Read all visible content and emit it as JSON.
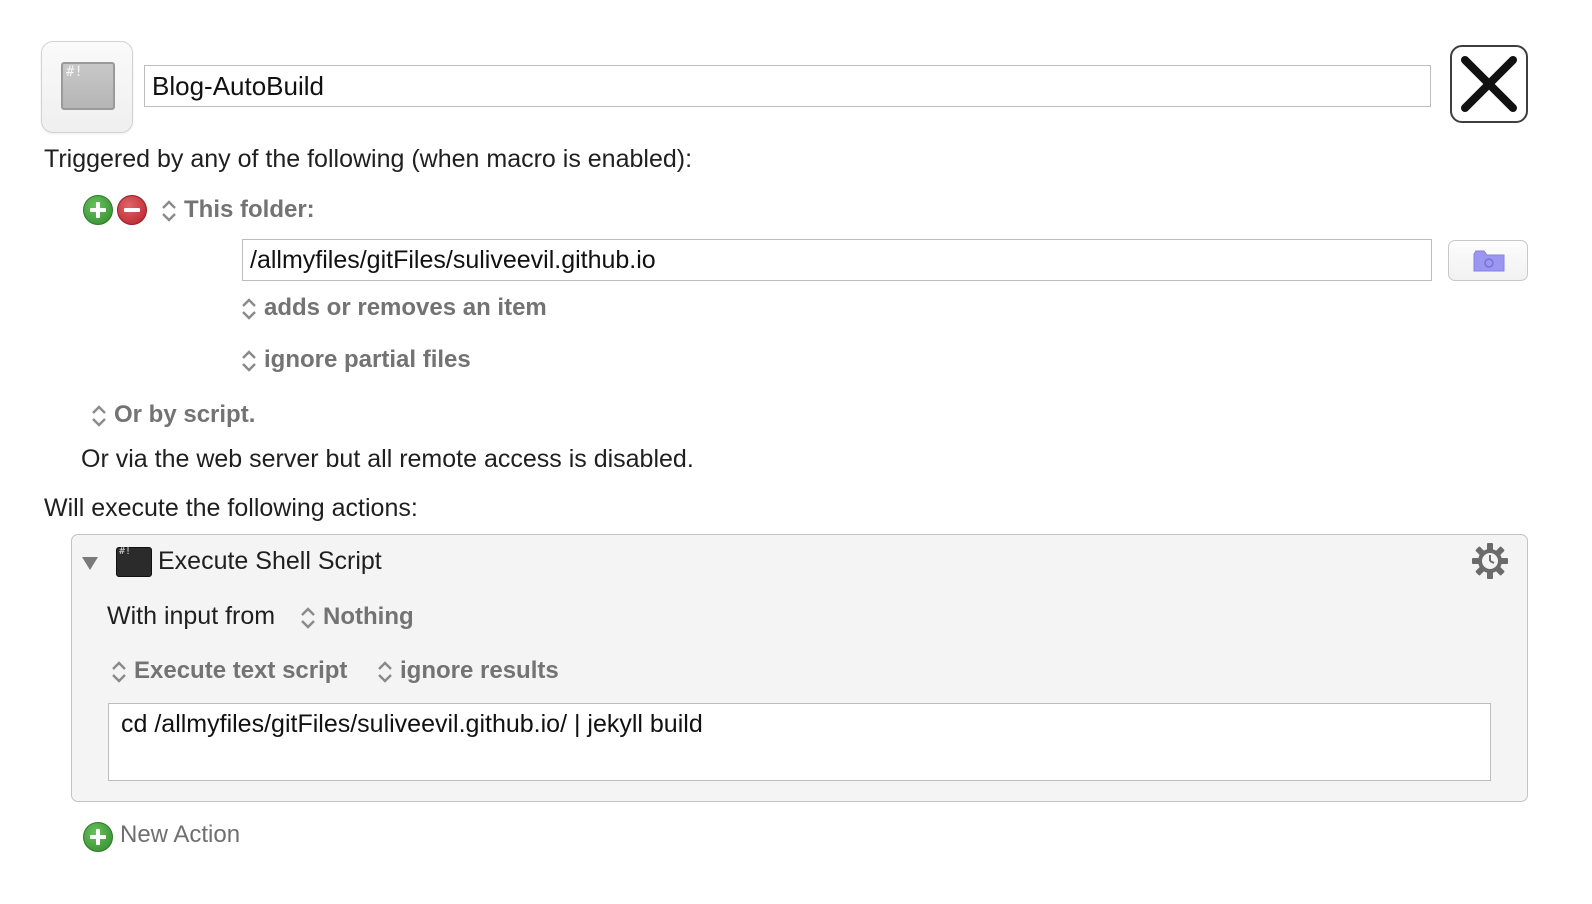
{
  "macro": {
    "icon_name": "shell-script-icon",
    "icon_glyph": "#!",
    "name": "Blog-AutoBuild",
    "close_icon": "close-x-icon"
  },
  "triggers": {
    "heading": "Triggered by any of the following (when macro is enabled):",
    "folder_trigger": {
      "type_label": "This folder:",
      "path": "/allmyfiles/gitFiles/suliveevil.github.io",
      "condition": "adds or removes an item",
      "partial_files": "ignore partial files"
    },
    "script_trigger": "Or by script.",
    "web_server": "Or via the web server but all remote access is disabled."
  },
  "actions": {
    "heading": "Will execute the following actions:",
    "items": [
      {
        "title": "Execute Shell Script",
        "icon_glyph": "#!",
        "input_label": "With input from",
        "input_value": "Nothing",
        "mode": "Execute text script",
        "results": "ignore results",
        "script": "cd /allmyfiles/gitFiles/suliveevil.github.io/ | jekyll build"
      }
    ],
    "new_action": "New Action"
  },
  "colors": {
    "add_green": "#2f8a2a",
    "remove_red": "#b32028",
    "popup_gray": "#737373",
    "folder_purple": "#9b97f0"
  }
}
